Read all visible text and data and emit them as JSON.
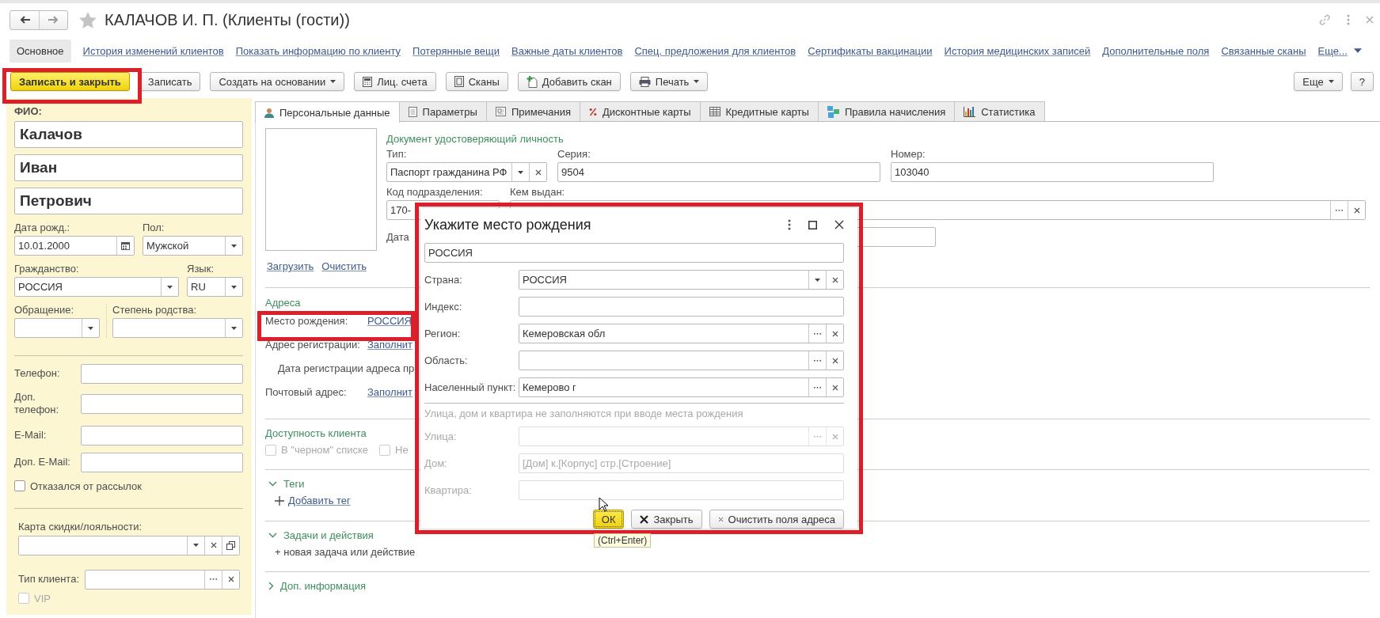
{
  "window": {
    "title": "КАЛАЧОВ И. П. (Клиенты (гости))"
  },
  "section_links": [
    {
      "label": "Основное",
      "selected": true
    },
    {
      "label": "История изменений клиентов",
      "selected": false
    },
    {
      "label": "Показать информацию по клиенту",
      "selected": false
    },
    {
      "label": "Потерянные вещи",
      "selected": false
    },
    {
      "label": "Важные даты клиентов",
      "selected": false
    },
    {
      "label": "Спец. предложения для клиентов",
      "selected": false
    },
    {
      "label": "Сертификаты вакцинации",
      "selected": false
    },
    {
      "label": "История медицинских записей",
      "selected": false
    },
    {
      "label": "Дополнительные поля",
      "selected": false
    },
    {
      "label": "Связанные сканы",
      "selected": false
    },
    {
      "label": "Еще...",
      "selected": false
    }
  ],
  "toolbar": [
    {
      "label": "Записать и закрыть",
      "kind": "default"
    },
    {
      "label": "Записать",
      "kind": "plain"
    },
    {
      "label": "Создать на основании",
      "kind": "menu"
    },
    {
      "label": "Лиц. счета",
      "kind": "plain"
    },
    {
      "label": "Сканы",
      "kind": "plain"
    },
    {
      "label": "Добавить скан",
      "kind": "plain"
    },
    {
      "label": "Печать",
      "kind": "menu"
    }
  ],
  "toolbar_right": [
    {
      "label": "Еще",
      "kind": "menu"
    },
    {
      "label": "?",
      "kind": "plain"
    }
  ],
  "client": {
    "fio_label": "ФИО:",
    "last_name": "Калачов",
    "first_name": "Иван",
    "middle_name": "Петрович",
    "birth_date": {
      "label": "Дата рожд.:",
      "value": "10.01.2000"
    },
    "gender": {
      "label": "Пол:",
      "value": "Мужской"
    },
    "citizenship": {
      "label": "Гражданство:",
      "value": "РОССИЯ"
    },
    "language": {
      "label": "Язык:",
      "value": "RU"
    },
    "salutation": {
      "label": "Обращение:"
    },
    "kinship": {
      "label": "Степень родства:"
    },
    "contacts": [
      {
        "label": "Телефон:"
      },
      {
        "label": "Доп. телефон:"
      },
      {
        "label": "E-Mail:"
      },
      {
        "label": "Доп. E-Mail:"
      }
    ],
    "unsubscribed": {
      "label": "Отказался от рассылок",
      "checked": false
    },
    "loyalty_card": {
      "label": "Карта скидки/лояльности:"
    },
    "client_type": {
      "label": "Тип клиента:"
    },
    "vip": {
      "label": "VIP",
      "checked": false,
      "disabled": true
    }
  },
  "tabs": [
    {
      "label": "Персональные данные",
      "selected": true
    },
    {
      "label": "Параметры",
      "selected": false
    },
    {
      "label": "Примечания",
      "selected": false
    },
    {
      "label": "Дисконтные карты",
      "selected": false
    },
    {
      "label": "Кредитные карты",
      "selected": false
    },
    {
      "label": "Правила начисления",
      "selected": false
    },
    {
      "label": "Статистика",
      "selected": false
    }
  ],
  "personal": {
    "photo_links": [
      "Загрузить",
      "Очистить"
    ],
    "document": {
      "title": "Документ удостоверяющий личность",
      "type": {
        "label": "Тип:",
        "value": "Паспорт гражданина РФ"
      },
      "series": {
        "label": "Серия:",
        "value": "9504"
      },
      "number": {
        "label": "Номер:",
        "value": "103040"
      },
      "division_code": {
        "label": "Код подразделения:",
        "value": "170-"
      },
      "issued_by": {
        "label": "Кем выдан:"
      },
      "issue_date": {
        "label": "Дата"
      }
    },
    "addresses": {
      "title": "Адреса",
      "rows": [
        {
          "kind": "link",
          "label": "Место рождения:",
          "value": "РОССИЯ"
        },
        {
          "kind": "link",
          "label": "Адрес регистрации:",
          "value": "Заполнит"
        },
        {
          "kind": "date",
          "label": "Дата регистрации адреса пр"
        },
        {
          "kind": "link",
          "label": "Почтовый адрес:",
          "value": "Заполнит"
        }
      ]
    },
    "availability": {
      "title": "Доступность клиента",
      "options": [
        {
          "label": "В \"черном\" списке",
          "checked": false,
          "disabled": true
        },
        {
          "label": "Не",
          "checked": false,
          "disabled": true
        }
      ]
    },
    "sections": [
      {
        "title": "Теги",
        "expanded": true,
        "kind": "link",
        "action": "Добавить тег"
      },
      {
        "title": "Задачи и действия",
        "expanded": true,
        "kind": "command",
        "action": "+ новая задача или действие"
      },
      {
        "title": "Доп. информация",
        "expanded": false
      }
    ]
  },
  "dialog": {
    "title": "Укажите место рождения",
    "presentation": "РОССИЯ",
    "fields": [
      {
        "label": "Страна:",
        "value": "РОССИЯ",
        "kind": "dropdown",
        "disabled": false
      },
      {
        "label": "Индекс:",
        "kind": "text",
        "disabled": false
      },
      {
        "label": "Регион:",
        "value": "Кемеровская обл",
        "kind": "choice",
        "disabled": false
      },
      {
        "label": "Область:",
        "kind": "choice",
        "disabled": false
      },
      {
        "label": "Населенный пункт:",
        "value": "Кемерово г",
        "kind": "choice",
        "disabled": false
      }
    ],
    "note": "Улица, дом и квартира не заполняются при вводе места рождения",
    "street_fields": [
      {
        "label": "Улица:",
        "kind": "choice",
        "disabled": true
      },
      {
        "label": "Дом:",
        "kind": "text",
        "placeholder": "[Дом] к.[Корпус] стр.[Строение]",
        "disabled": true
      },
      {
        "label": "Квартира:",
        "kind": "text",
        "disabled": true
      }
    ],
    "buttons": [
      {
        "label": "ОК",
        "kind": "default"
      },
      {
        "label": "Закрыть",
        "kind": "close"
      },
      {
        "label": "Очистить поля адреса",
        "kind": "clear"
      }
    ],
    "tooltip": "(Ctrl+Enter)"
  }
}
